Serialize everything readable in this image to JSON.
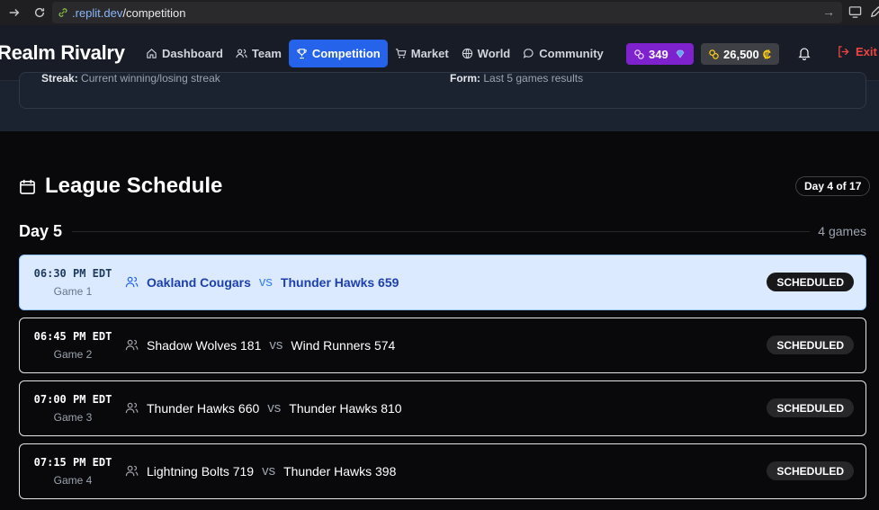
{
  "browser": {
    "url_host": ".replit.dev",
    "url_path": "/competition"
  },
  "header": {
    "brand": "Realm Rivalry",
    "nav": [
      {
        "label": "Dashboard",
        "icon": "home-icon"
      },
      {
        "label": "Team",
        "icon": "users-icon"
      },
      {
        "label": "Competition",
        "icon": "trophy-icon",
        "active": true
      },
      {
        "label": "Market",
        "icon": "cart-icon"
      },
      {
        "label": "World",
        "icon": "globe-icon"
      },
      {
        "label": "Community",
        "icon": "chat-icon"
      }
    ],
    "gems": "349",
    "coins": "26,500",
    "coin_symbol": "₡",
    "exit_label": "Exit"
  },
  "stats_remnant": {
    "left_label": "Streak:",
    "left_text": "Current winning/losing streak",
    "right_label": "Form:",
    "right_text": "Last 5 games results"
  },
  "schedule": {
    "title": "League Schedule",
    "day_badge": "Day 4 of 17",
    "day_label": "Day 5",
    "game_count": "4 games",
    "games": [
      {
        "time": "06:30 PM EDT",
        "game": "Game 1",
        "home": "Oakland Cougars",
        "vs": "vs",
        "away": "Thunder Hawks 659",
        "status": "SCHEDULED"
      },
      {
        "time": "06:45 PM EDT",
        "game": "Game 2",
        "home": "Shadow Wolves 181",
        "vs": "vs",
        "away": "Wind Runners 574",
        "status": "SCHEDULED"
      },
      {
        "time": "07:00 PM EDT",
        "game": "Game 3",
        "home": "Thunder Hawks 660",
        "vs": "vs",
        "away": "Thunder Hawks 810",
        "status": "SCHEDULED"
      },
      {
        "time": "07:15 PM EDT",
        "game": "Game 4",
        "home": "Lightning Bolts 719",
        "vs": "vs",
        "away": "Thunder Hawks 398",
        "status": "SCHEDULED"
      }
    ]
  },
  "colors": {
    "accent": "#2563eb",
    "gems_pill": "#7e22ce",
    "exit": "#ef4444",
    "highlight_row": "#dbeafe"
  }
}
